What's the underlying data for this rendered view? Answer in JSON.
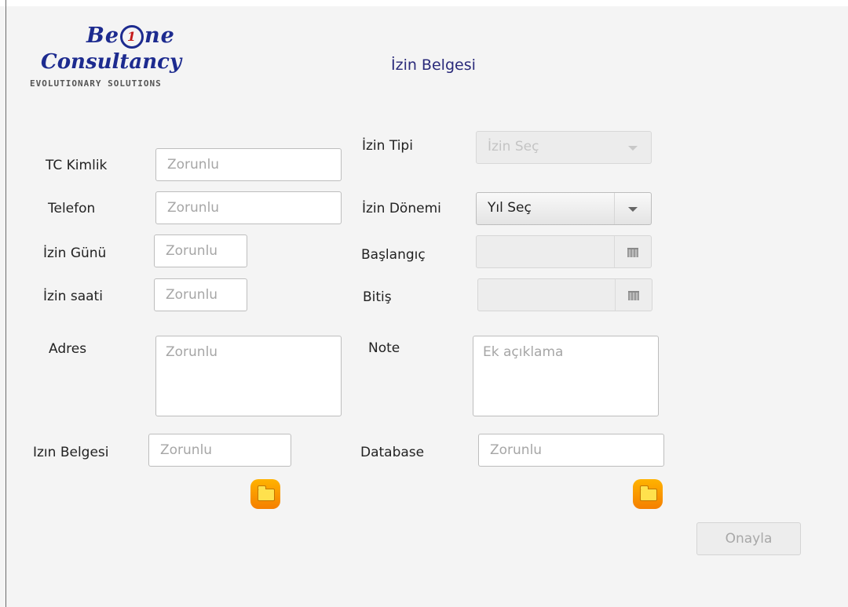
{
  "logo": {
    "line1_a": "Be",
    "line1_one": "1",
    "line1_b": "ne",
    "line2": "Consultancy",
    "line3": "EVOLUTIONARY SOLUTIONS"
  },
  "title": "İzin Belgesi",
  "form": {
    "tc_label": "TC Kimlik",
    "tc_placeholder": "Zorunlu",
    "phone_label": "Telefon",
    "phone_placeholder": "Zorunlu",
    "day_label": "İzin Günü",
    "day_placeholder": "Zorunlu",
    "hour_label": "İzin saati",
    "hour_placeholder": "Zorunlu",
    "address_label": "Adres",
    "address_placeholder": "Zorunlu",
    "doc_label": "Izın Belgesi",
    "doc_placeholder": "Zorunlu",
    "type_label": "İzin Tipi",
    "type_value": "İzin Seç",
    "period_label": "İzin Dönemi",
    "period_value": "Yıl Seç",
    "start_label": "Başlangıç",
    "end_label": "Bitiş",
    "note_label": "Note",
    "note_placeholder": "Ek açıklama",
    "db_label": "Database",
    "db_placeholder": "Zorunlu"
  },
  "confirm_button": "Onayla",
  "icons": {
    "folder": "folder-icon",
    "calendar": "calendar-icon",
    "dropdown": "chevron-down-icon"
  },
  "colors": {
    "title": "#2a2a7a",
    "logo_blue": "#1d2b8f",
    "folder_orange": "#f57f00"
  }
}
